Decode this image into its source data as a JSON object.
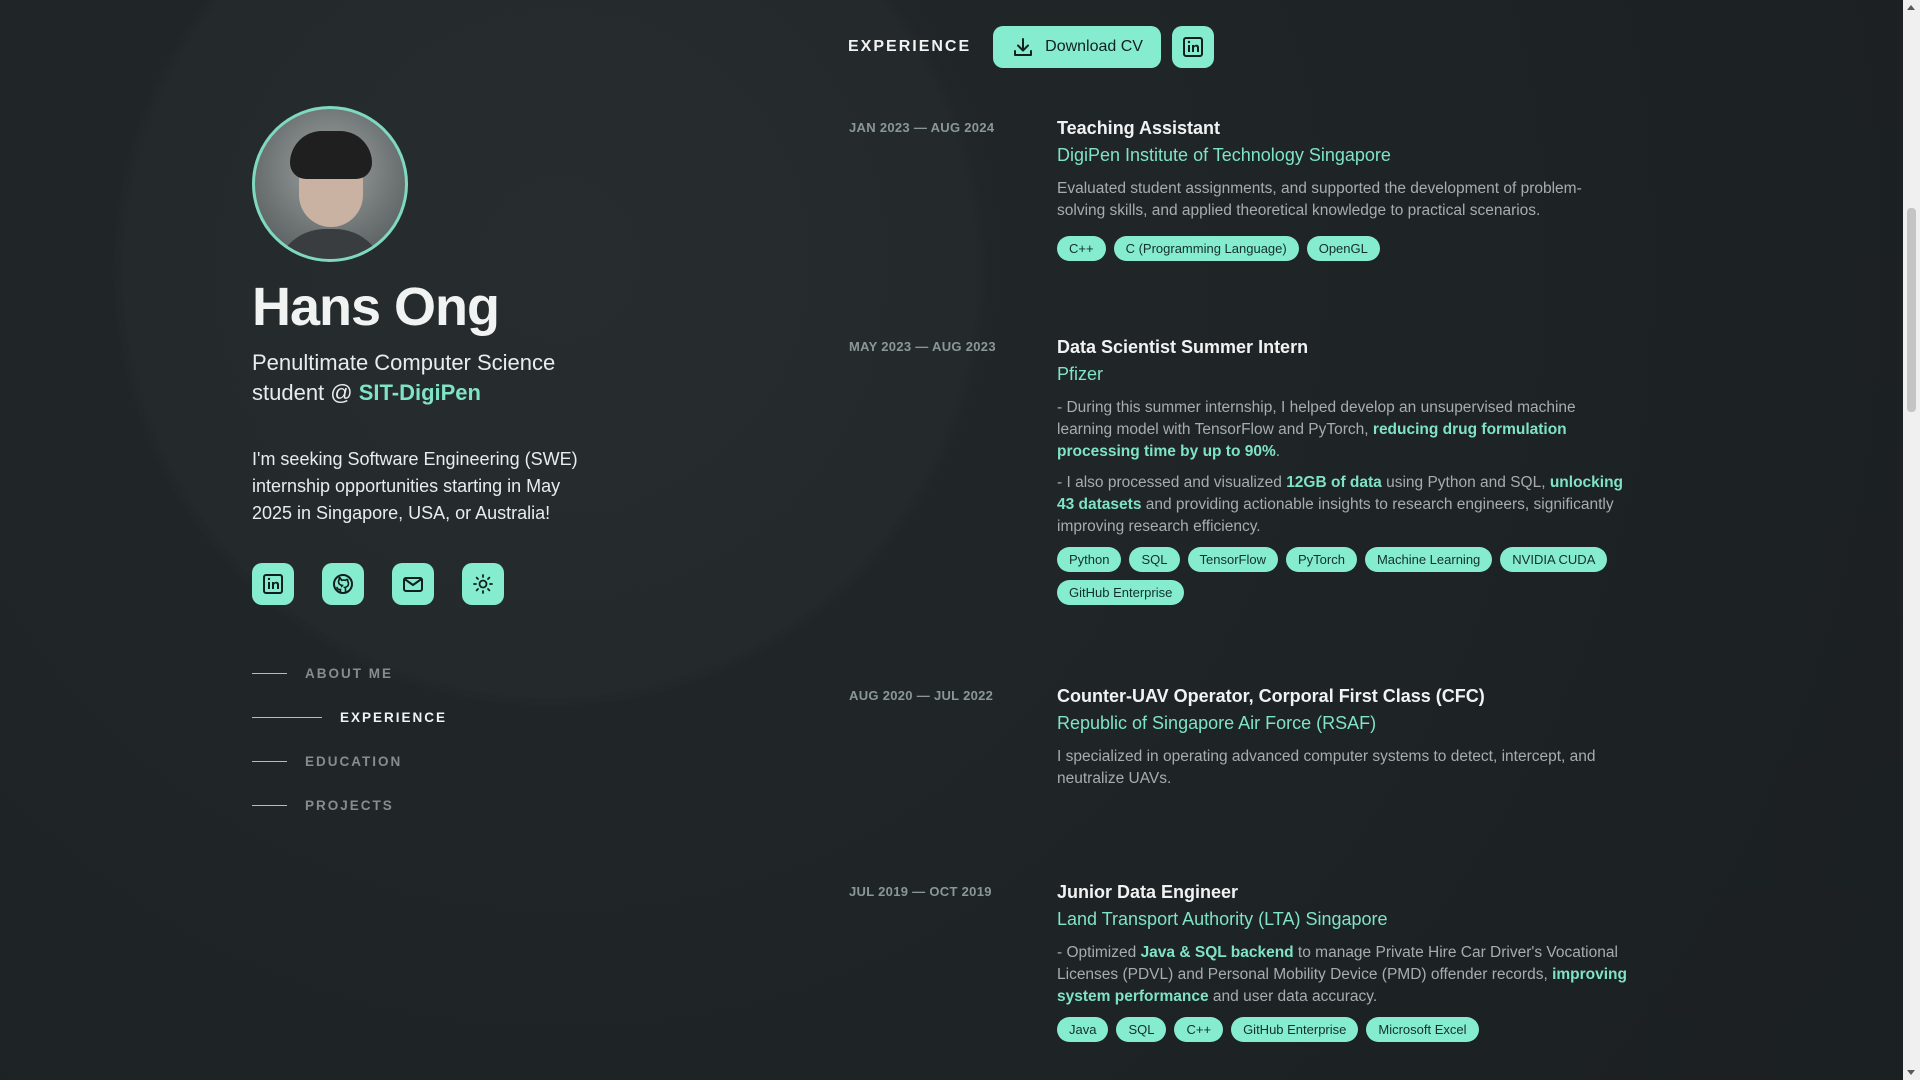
{
  "profile": {
    "name": "Hans Ong",
    "subtitle_prefix": "Penultimate Computer Science student @ ",
    "subtitle_highlight": "SIT-DigiPen",
    "intro": "I'm seeking Software Engineering (SWE) internship opportunities starting in May 2025 in Singapore, USA, or Australia!"
  },
  "socials": [
    {
      "icon": "linkedin-icon"
    },
    {
      "icon": "github-icon"
    },
    {
      "icon": "mail-icon"
    },
    {
      "icon": "sun-icon"
    }
  ],
  "nav": {
    "items": [
      {
        "label": "ABOUT ME",
        "active": false
      },
      {
        "label": "EXPERIENCE",
        "active": true
      },
      {
        "label": "EDUCATION",
        "active": false
      },
      {
        "label": "PROJECTS",
        "active": false
      }
    ]
  },
  "topbar": {
    "section_title": "EXPERIENCE",
    "download_cv_label": "Download CV"
  },
  "experiences": [
    {
      "date": "JAN 2023 — AUG 2024",
      "title": "Teaching Assistant",
      "company": "DigiPen Institute of Technology Singapore",
      "desc1": "Evaluated student assignments, and supported the development of problem-solving skills, and applied theoretical knowledge to practical scenarios.",
      "tags": [
        "C++",
        "C (Programming Language)",
        "OpenGL"
      ]
    },
    {
      "date": "MAY 2023 — AUG 2023",
      "title": "Data Scientist Summer Intern",
      "company": "Pfizer",
      "p1_a": "- During this summer internship, I helped develop an unsupervised machine learning model with TensorFlow and PyTorch, ",
      "p1_hl": "reducing drug formulation processing time by up to 90%",
      "p1_b": ".",
      "p2_a": "- I also processed and visualized ",
      "p2_hl1": "12GB of data",
      "p2_b": " using Python and SQL, ",
      "p2_hl2": "unlocking 43 datasets",
      "p2_c": " and providing actionable insights to research engineers, significantly improving research efficiency.",
      "tags": [
        "Python",
        "SQL",
        "TensorFlow",
        "PyTorch",
        "Machine Learning",
        "NVIDIA CUDA",
        "GitHub Enterprise"
      ]
    },
    {
      "date": "AUG 2020 — JUL 2022",
      "title": "Counter-UAV Operator, Corporal First Class (CFC)",
      "company": "Republic of Singapore Air Force (RSAF)",
      "desc1": "I specialized in operating advanced computer systems to detect, intercept, and neutralize UAVs.",
      "tags": []
    },
    {
      "date": "JUL 2019 — OCT 2019",
      "title": "Junior Data Engineer",
      "company": "Land Transport Authority (LTA) Singapore",
      "p1_a": "- Optimized ",
      "p1_hl": "Java & SQL backend",
      "p1_b": " to manage Private Hire Car Driver's Vocational Licenses (PDVL) and Personal Mobility Device (PMD) offender records, ",
      "p1_hl2": "improving system performance",
      "p1_c": " and user data accuracy.",
      "tags": [
        "Java",
        "SQL",
        "C++",
        "GitHub Enterprise",
        "Microsoft Excel"
      ]
    }
  ],
  "colors": {
    "accent": "#86ecd0",
    "accent_text": "#7fe3c6",
    "background": "#1d2224"
  }
}
